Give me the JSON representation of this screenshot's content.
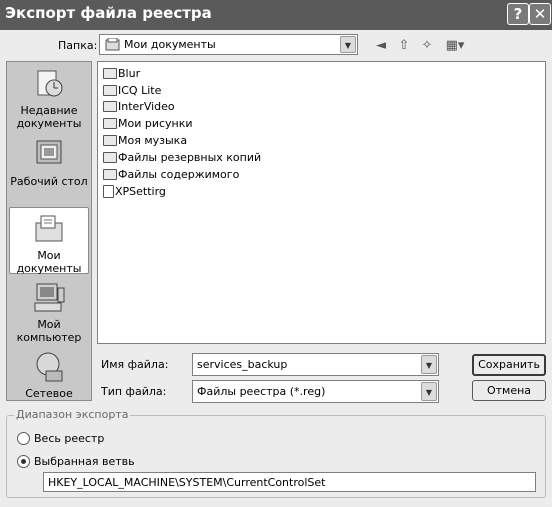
{
  "window": {
    "title": "Экспорт файла реестра",
    "help_label": "?",
    "close_label": "✕"
  },
  "lookin": {
    "label": "Папка:",
    "value": "Мои документы"
  },
  "toolbar": {
    "back_icon": "back-icon",
    "up_icon": "up-folder-icon",
    "new_icon": "new-folder-icon",
    "view_icon": "view-menu-icon"
  },
  "places": [
    {
      "label": "Недавние документы",
      "icon": "recent-documents-icon"
    },
    {
      "label": "Рабочий стол",
      "icon": "desktop-icon"
    },
    {
      "label": "Мои документы",
      "icon": "my-documents-icon",
      "selected": true
    },
    {
      "label": "Мой компьютер",
      "icon": "my-computer-icon"
    },
    {
      "label": "Сетевое",
      "icon": "network-icon"
    }
  ],
  "files": [
    {
      "name": "Blur",
      "type": "folder"
    },
    {
      "name": "ICQ Lite",
      "type": "folder"
    },
    {
      "name": "InterVideo",
      "type": "folder"
    },
    {
      "name": "Мои рисунки",
      "type": "folder"
    },
    {
      "name": "Моя музыка",
      "type": "folder"
    },
    {
      "name": "Файлы резервных копий",
      "type": "folder"
    },
    {
      "name": "Файлы содержимого",
      "type": "folder"
    },
    {
      "name": "XPSettirg",
      "type": "reg-file"
    }
  ],
  "filename": {
    "label": "Имя файла:",
    "value": "services_backup"
  },
  "filetype": {
    "label": "Тип файла:",
    "value": "Файлы реестра (*.reg)"
  },
  "buttons": {
    "save": "Сохранить",
    "cancel": "Отмена"
  },
  "range": {
    "title": "Диапазон экспорта",
    "all_label": "Весь реестр",
    "branch_label": "Выбранная ветвь",
    "selected": "branch",
    "branch_value": "HKEY_LOCAL_MACHINE\\SYSTEM\\CurrentControlSet"
  }
}
